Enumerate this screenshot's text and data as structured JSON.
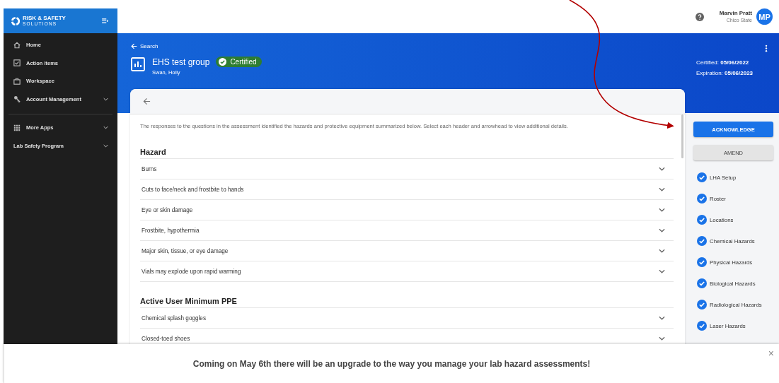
{
  "sidebar": {
    "logo": {
      "line1": "RISK & SAFETY",
      "line2": "SOLUTIONS"
    },
    "groups": [
      [
        {
          "label": "Home",
          "expandable": false
        },
        {
          "label": "Action Items",
          "expandable": false
        },
        {
          "label": "Workspace",
          "expandable": false
        },
        {
          "label": "Account Management",
          "expandable": true
        }
      ],
      [
        {
          "label": "More Apps",
          "expandable": true
        },
        {
          "label": "Lab Safety Program",
          "expandable": true
        }
      ]
    ]
  },
  "user": {
    "name": "Marvin Pratt",
    "org": "Chico State",
    "initials": "MP"
  },
  "header": {
    "back_link": "Search",
    "title": "EHS test group",
    "badge": "Certified",
    "subtitle": "Swan, Holly",
    "certified": "Certified: **05/06/2022**",
    "expiration": "Expiration: **05/06/2023**"
  },
  "card": {
    "intro": "The responses to the questions in the assessment identified the hazards and protective equipment summarized below. Select each header and arrowhead to view additional details.",
    "sections": [
      {
        "heading": "Hazard",
        "rows": [
          {
            "label": "Burns",
            "expanded": false
          },
          {
            "label": "Cuts to face/neck and frostbite to hands",
            "expanded": false
          },
          {
            "label": "Eye or skin damage",
            "expanded": false
          },
          {
            "label": "Frostbite, hypothermia",
            "expanded": false
          },
          {
            "label": "Major skin, tissue, or eye damage",
            "expanded": false
          },
          {
            "label": "Vials may explode upon rapid warming",
            "expanded": false
          }
        ]
      },
      {
        "heading": "Active User Minimum PPE",
        "rows": [
          {
            "label": "Chemical splash goggles",
            "expanded": false
          },
          {
            "label": "Closed-toed shoes",
            "expanded": false
          }
        ]
      }
    ]
  },
  "actions": [
    {
      "label": "ACKNOWLEDGE",
      "kind": "primary"
    },
    {
      "label": "AMEND",
      "kind": "secondary"
    }
  ],
  "steps": [
    {
      "label": "LHA Setup",
      "completed": true
    },
    {
      "label": "Roster",
      "completed": true
    },
    {
      "label": "Locations",
      "completed": true
    },
    {
      "label": "Chemical Hazards",
      "completed": true
    },
    {
      "label": "Physical Hazards",
      "completed": true
    },
    {
      "label": "Biological Hazards",
      "completed": true
    },
    {
      "label": "Radiological Hazards",
      "completed": true
    },
    {
      "label": "Laser Hazards",
      "completed": true
    }
  ],
  "banner": {
    "message": "Coming on May 6th there will be an upgrade to the way you manage your lab hazard assessments!",
    "close": "×"
  }
}
